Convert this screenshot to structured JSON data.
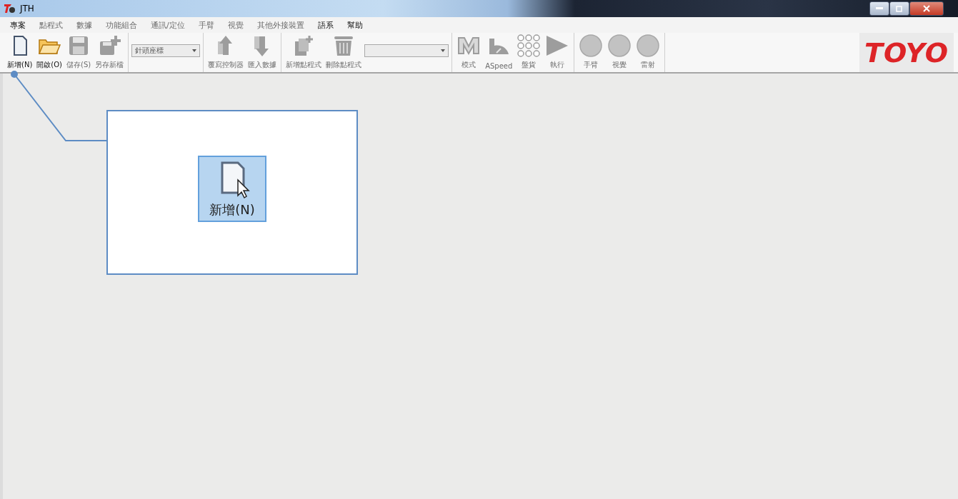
{
  "window": {
    "title": "JTH"
  },
  "menu": [
    {
      "label": "專案",
      "disabled": false
    },
    {
      "label": "點程式",
      "disabled": true
    },
    {
      "label": "數據",
      "disabled": true
    },
    {
      "label": "功能組合",
      "disabled": true
    },
    {
      "label": "通訊/定位",
      "disabled": true
    },
    {
      "label": "手臂",
      "disabled": true
    },
    {
      "label": "視覺",
      "disabled": true
    },
    {
      "label": "其他外接裝置",
      "disabled": true
    },
    {
      "label": "語系",
      "disabled": false
    },
    {
      "label": "幫助",
      "disabled": false
    }
  ],
  "toolbar": [
    [
      {
        "kind": "new",
        "label": "新增(N)",
        "disabled": false
      },
      {
        "kind": "open",
        "label": "開啟(O)",
        "disabled": false
      },
      {
        "kind": "save",
        "label": "儲存(S)",
        "disabled": true
      },
      {
        "kind": "saveas",
        "label": "另存新檔",
        "disabled": true
      }
    ],
    [
      {
        "kind": "combo",
        "value": "針頭座標",
        "disabled": true
      }
    ],
    [
      {
        "kind": "upload",
        "label": "覆寫控制器",
        "disabled": true
      },
      {
        "kind": "download",
        "label": "匯入數據",
        "disabled": true
      }
    ],
    [
      {
        "kind": "addprog",
        "label": "新增點程式",
        "disabled": true
      },
      {
        "kind": "trash",
        "label": "刪除點程式",
        "disabled": true
      },
      {
        "kind": "combo",
        "disabled": true
      }
    ],
    [
      {
        "kind": "mode",
        "label": "模式",
        "disabled": true
      },
      {
        "kind": "speed",
        "label": "ASpeed",
        "disabled": true
      },
      {
        "kind": "grid",
        "label": "盤貨",
        "disabled": true
      },
      {
        "kind": "play",
        "label": "執行",
        "disabled": true
      }
    ],
    [
      {
        "kind": "circle",
        "label": "手臂",
        "disabled": true
      },
      {
        "kind": "circle",
        "label": "視覺",
        "disabled": true
      },
      {
        "kind": "circle",
        "label": "雷射",
        "disabled": true
      }
    ]
  ],
  "logo": "TOYO",
  "callout": {
    "label": "新增(N)",
    "selected": true
  }
}
